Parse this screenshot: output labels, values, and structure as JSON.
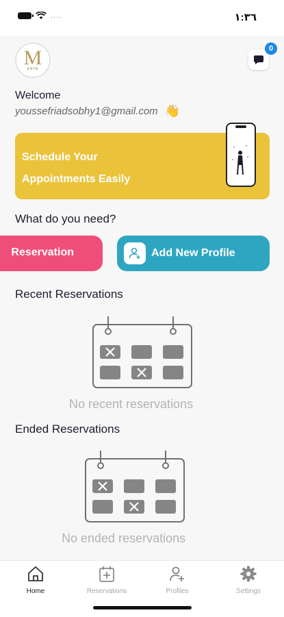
{
  "status_bar": {
    "time": "١:٣٦",
    "carrier_dots": "...."
  },
  "header": {
    "logo_letter": "M",
    "logo_sub": "ENTA",
    "notifications_count": "0"
  },
  "welcome": {
    "title": "Welcome",
    "email": "youssefriadsobhy1@gmail.com",
    "wave": "👋"
  },
  "banner": {
    "line1": "Schedule Your",
    "line2": "Appointments Easily"
  },
  "actions": {
    "heading": "What do you need?",
    "reservation_label": "Reservation",
    "add_profile_label": "Add New Profile"
  },
  "recent": {
    "heading": "Recent Reservations",
    "empty_text": "No recent reservations"
  },
  "ended": {
    "heading": "Ended Reservations",
    "empty_text": "No ended reservations"
  },
  "tabs": [
    {
      "label": "Home",
      "icon": "home-icon",
      "active": true
    },
    {
      "label": "Reservations",
      "icon": "calendar-plus-icon",
      "active": false
    },
    {
      "label": "Profiles",
      "icon": "add-user-icon",
      "active": false
    },
    {
      "label": "Settings",
      "icon": "gear-icon",
      "active": false
    }
  ],
  "colors": {
    "accent_yellow": "#ebc33b",
    "reservation_pink": "#f04e7a",
    "profile_teal": "#2ea6c1",
    "badge_blue": "#1e88e5"
  }
}
